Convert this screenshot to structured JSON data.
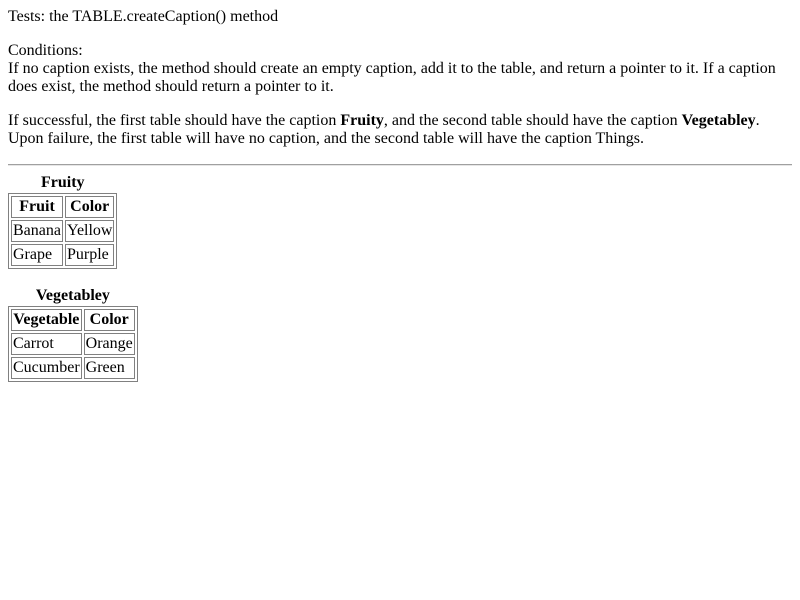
{
  "heading": "Tests: the TABLE.createCaption() method",
  "conditions": {
    "label": "Conditions:",
    "text": "If no caption exists, the method should create an empty caption, add it to the table, and return a pointer to it. If a caption does exist, the method should return a pointer to it."
  },
  "expectation": {
    "prefix": "If successful, the first table should have the caption ",
    "first_caption": "Fruity",
    "middle": ", and the second table should have the caption ",
    "second_caption": "Vegetabley",
    "suffix": ". Upon failure, the first table will have no caption, and the second table will have the caption Things."
  },
  "table1": {
    "caption": "Fruity",
    "headers": [
      "Fruit",
      "Color"
    ],
    "rows": [
      [
        "Banana",
        "Yellow"
      ],
      [
        "Grape",
        "Purple"
      ]
    ]
  },
  "table2": {
    "caption": "Vegetabley",
    "headers": [
      "Vegetable",
      "Color"
    ],
    "rows": [
      [
        "Carrot",
        "Orange"
      ],
      [
        "Cucumber",
        "Green"
      ]
    ]
  }
}
